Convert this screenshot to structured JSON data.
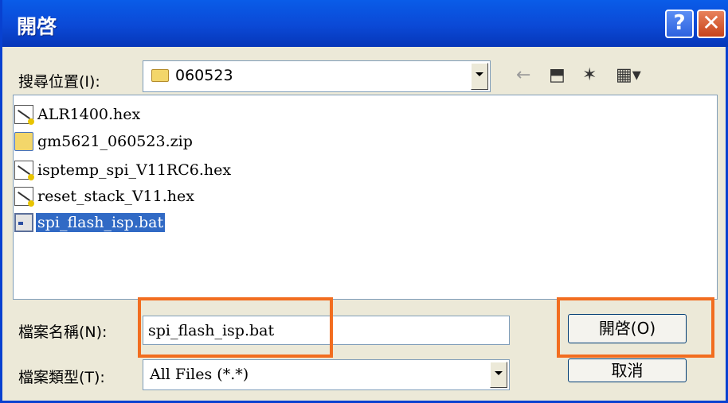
{
  "window": {
    "title": "開啓"
  },
  "titlebar": {
    "help_label": "?",
    "close_label": "✕"
  },
  "lookin": {
    "label": "搜尋位置(I):",
    "value": "060523"
  },
  "toolbar": {
    "back_glyph": "←",
    "up_glyph": "⬒",
    "newfolder_glyph": "✶",
    "views_glyph": "▦▾"
  },
  "files": [
    {
      "name": "ALR1400.hex",
      "type": "hex",
      "selected": false
    },
    {
      "name": "gm5621_060523.zip",
      "type": "zip",
      "selected": false
    },
    {
      "name": "isptemp_spi_V11RC6.hex",
      "type": "hex",
      "selected": false
    },
    {
      "name": "reset_stack_V11.hex",
      "type": "hex",
      "selected": false
    },
    {
      "name": "spi_flash_isp.bat",
      "type": "bat",
      "selected": true
    }
  ],
  "filename": {
    "label": "檔案名稱(N):",
    "value": "spi_flash_isp.bat"
  },
  "filetype": {
    "label": "檔案類型(T):",
    "value": "All Files (*.*)"
  },
  "buttons": {
    "open": "開啓(O)",
    "cancel": "取消"
  },
  "colors": {
    "title_blue": "#0b49d6",
    "selection": "#316ac5",
    "highlight_box": "#f26d1f"
  }
}
